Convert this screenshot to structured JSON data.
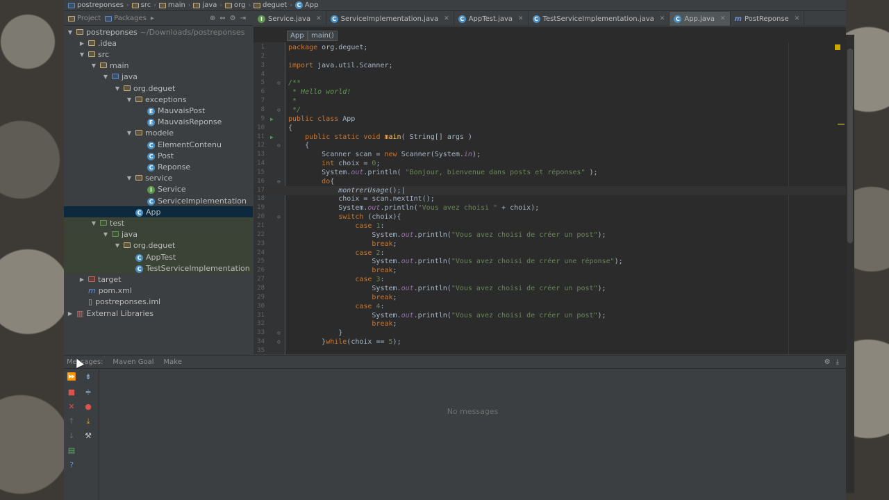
{
  "breadcrumb": [
    "postreponses",
    "src",
    "main",
    "java",
    "org",
    "deguet",
    "App"
  ],
  "project_panel": {
    "project_tab": "Project",
    "packages_tab": "Packages"
  },
  "tree": [
    {
      "label": "postreponses",
      "extra": "~/Downloads/postreponses",
      "depth": 0,
      "toggle": "▼",
      "icon": "folder-icon"
    },
    {
      "label": ".idea",
      "depth": 1,
      "toggle": "▶",
      "icon": "folder-icon"
    },
    {
      "label": "src",
      "depth": 1,
      "toggle": "▼",
      "icon": "folder-icon"
    },
    {
      "label": "main",
      "depth": 2,
      "toggle": "▼",
      "icon": "folder-icon"
    },
    {
      "label": "java",
      "depth": 3,
      "toggle": "▼",
      "icon": "source-folder-icon"
    },
    {
      "label": "org.deguet",
      "depth": 4,
      "toggle": "▼",
      "icon": "package-icon"
    },
    {
      "label": "exceptions",
      "depth": 5,
      "toggle": "▼",
      "icon": "package-icon"
    },
    {
      "label": "MauvaisPost",
      "depth": 6,
      "toggle": "",
      "icon": "exception-class-icon"
    },
    {
      "label": "MauvaisReponse",
      "depth": 6,
      "toggle": "",
      "icon": "exception-class-icon"
    },
    {
      "label": "modele",
      "depth": 5,
      "toggle": "▼",
      "icon": "package-icon"
    },
    {
      "label": "ElementContenu",
      "depth": 6,
      "toggle": "",
      "icon": "class-icon"
    },
    {
      "label": "Post",
      "depth": 6,
      "toggle": "",
      "icon": "class-icon"
    },
    {
      "label": "Reponse",
      "depth": 6,
      "toggle": "",
      "icon": "class-icon"
    },
    {
      "label": "service",
      "depth": 5,
      "toggle": "▼",
      "icon": "package-icon"
    },
    {
      "label": "Service",
      "depth": 6,
      "toggle": "",
      "icon": "interface-icon"
    },
    {
      "label": "ServiceImplementation",
      "depth": 6,
      "toggle": "",
      "icon": "class-icon"
    },
    {
      "label": "App",
      "depth": 5,
      "toggle": "",
      "icon": "class-icon",
      "selected": true
    },
    {
      "label": "test",
      "depth": 2,
      "toggle": "▼",
      "icon": "test-folder-icon",
      "test": true
    },
    {
      "label": "java",
      "depth": 3,
      "toggle": "▼",
      "icon": "test-source-folder-icon",
      "test": true
    },
    {
      "label": "org.deguet",
      "depth": 4,
      "toggle": "▼",
      "icon": "package-icon",
      "test": true
    },
    {
      "label": "AppTest",
      "depth": 5,
      "toggle": "",
      "icon": "test-class-icon",
      "test": true
    },
    {
      "label": "TestServiceImplementation",
      "depth": 5,
      "toggle": "",
      "icon": "test-class-icon",
      "test": true
    },
    {
      "label": "target",
      "depth": 1,
      "toggle": "▶",
      "icon": "excluded-folder-icon"
    },
    {
      "label": "pom.xml",
      "depth": 1,
      "toggle": "",
      "icon": "xml-file-icon"
    },
    {
      "label": "postreponses.iml",
      "depth": 1,
      "toggle": "",
      "icon": "iml-file-icon"
    },
    {
      "label": "External Libraries",
      "depth": 0,
      "toggle": "▶",
      "icon": "libraries-icon"
    }
  ],
  "tabs": [
    {
      "label": "Service.java",
      "icon": "interface-icon",
      "active": false
    },
    {
      "label": "ServiceImplementation.java",
      "icon": "class-icon",
      "active": false
    },
    {
      "label": "AppTest.java",
      "icon": "test-class-icon",
      "active": false
    },
    {
      "label": "TestServiceImplementation.java",
      "icon": "test-class-icon",
      "active": false
    },
    {
      "label": "App.java",
      "icon": "class-icon",
      "active": true
    },
    {
      "label": "PostReponse",
      "icon": "maven-icon",
      "active": false
    }
  ],
  "editor_breadcrumb": {
    "class": "App",
    "method": "main()"
  },
  "code_lines": [
    {
      "n": "1",
      "html": "<span class=\"kw\">package</span> org.deguet;"
    },
    {
      "n": "2",
      "html": ""
    },
    {
      "n": "3",
      "html": "<span class=\"kw\">import</span> java.util.Scanner;"
    },
    {
      "n": "4",
      "html": ""
    },
    {
      "n": "5",
      "html": "<span class=\"cm\">/**</span>",
      "fold": "⊖"
    },
    {
      "n": "6",
      "html": "<span class=\"cm\"> * Hello world!</span>"
    },
    {
      "n": "7",
      "html": "<span class=\"cm\"> *</span>"
    },
    {
      "n": "8",
      "html": "<span class=\"cm\"> */</span>",
      "fold": "⊖"
    },
    {
      "n": "9",
      "html": "<span class=\"kw\">public class</span> App",
      "run": "▶"
    },
    {
      "n": "10",
      "html": "{"
    },
    {
      "n": "11",
      "html": "    <span class=\"kw\">public static void</span> <span class=\"fn\">main</span>( String[] args )",
      "run": "▶"
    },
    {
      "n": "12",
      "html": "    {",
      "fold": "⊖"
    },
    {
      "n": "13",
      "html": "        Scanner scan = <span class=\"kw\">new</span> Scanner(System.<span class=\"st\">in</span>);"
    },
    {
      "n": "14",
      "html": "        <span class=\"kw\">int</span> choix = <span class=\"str\">0</span>;"
    },
    {
      "n": "15",
      "html": "        System.<span class=\"st\">out</span>.println( <span class=\"str\">\"Bonjour, bienvenue dans posts et réponses\"</span> );"
    },
    {
      "n": "16",
      "html": "        <span class=\"kw\">do</span>{",
      "fold": "⊖"
    },
    {
      "n": "17",
      "html": "            <span class=\"it\">montrerUsage</span>();|",
      "cur": true
    },
    {
      "n": "18",
      "html": "            choix = scan.nextInt();"
    },
    {
      "n": "19",
      "html": "            System.<span class=\"st\">out</span>.println(<span class=\"str\">\"Vous avez choisi \"</span> + choix);"
    },
    {
      "n": "20",
      "html": "            <span class=\"kw\">switch</span> (choix){",
      "fold": "⊖"
    },
    {
      "n": "21",
      "html": "                <span class=\"kw\">case</span> <span class=\"str\">1</span>:"
    },
    {
      "n": "22",
      "html": "                    System.<span class=\"st\">out</span>.println(<span class=\"str\">\"Vous avez choisi de créer un post\"</span>);"
    },
    {
      "n": "23",
      "html": "                    <span class=\"kw\">break</span>;"
    },
    {
      "n": "24",
      "html": "                <span class=\"kw\">case</span> <span class=\"str\">2</span>:"
    },
    {
      "n": "25",
      "html": "                    System.<span class=\"st\">out</span>.println(<span class=\"str\">\"Vous avez choisi de créer une réponse\"</span>);"
    },
    {
      "n": "26",
      "html": "                    <span class=\"kw\">break</span>;"
    },
    {
      "n": "27",
      "html": "                <span class=\"kw\">case</span> <span class=\"str\">3</span>:"
    },
    {
      "n": "28",
      "html": "                    System.<span class=\"st\">out</span>.println(<span class=\"str\">\"Vous avez choisi de créer un post\"</span>);"
    },
    {
      "n": "29",
      "html": "                    <span class=\"kw\">break</span>;"
    },
    {
      "n": "30",
      "html": "                <span class=\"kw\">case</span> <span class=\"str\">4</span>:"
    },
    {
      "n": "31",
      "html": "                    System.<span class=\"st\">out</span>.println(<span class=\"str\">\"Vous avez choisi de créer un post\"</span>);"
    },
    {
      "n": "32",
      "html": "                    <span class=\"kw\">break</span>;"
    },
    {
      "n": "33",
      "html": "            }",
      "fold": "⊖"
    },
    {
      "n": "34",
      "html": "        }<span class=\"kw\">while</span>(choix == <span class=\"str\">5</span>);",
      "fold": "⊖"
    },
    {
      "n": "35",
      "html": ""
    }
  ],
  "bottom_panel": {
    "tabs": [
      "Messages:",
      "Maven Goal",
      "Make"
    ],
    "empty_text": "No messages"
  },
  "colors": {
    "background": "#2b2b2b",
    "keyword": "#cc7832",
    "string": "#6a8759",
    "selection": "#0d293e"
  }
}
